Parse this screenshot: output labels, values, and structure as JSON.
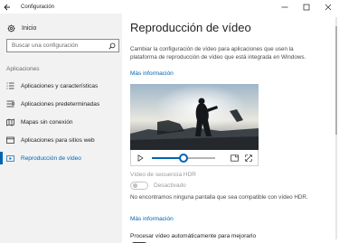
{
  "window": {
    "title": "Configuración",
    "controls": [
      "minimize-icon",
      "maximize-icon",
      "close-icon"
    ]
  },
  "sidebar": {
    "home_label": "Inicio",
    "search_placeholder": "Buscar una configuración",
    "section_label": "Aplicaciones",
    "items": [
      {
        "label": "Aplicaciones y características",
        "icon": "list-icon"
      },
      {
        "label": "Aplicaciones predeterminadas",
        "icon": "default-apps-icon"
      },
      {
        "label": "Mapas sin conexión",
        "icon": "map-icon"
      },
      {
        "label": "Aplicaciones para sitios web",
        "icon": "web-apps-icon"
      },
      {
        "label": "Reproducción de vídeo",
        "icon": "video-icon",
        "active": true
      }
    ]
  },
  "main": {
    "title": "Reproducción de vídeo",
    "description": "Cambiar la configuración de vídeo para aplicaciones que usen la plataforma de reproducción de vídeo que está integrada en Windows.",
    "more_info_1": "Más información",
    "video": {
      "progress": 0.5
    },
    "hdr_label": "Vídeo de secuencia HDR",
    "hdr_toggle_label": "Desactivado",
    "hdr_toggle_on": false,
    "hdr_note": "No encontramos ninguna pantalla que sea compatible con vídeo HDR.",
    "more_info_2": "Más información",
    "process_label": "Procesar vídeo automáticamente para mejorarlo"
  },
  "colors": {
    "accent": "#0063b1",
    "sidebar_bg": "#f2f2f2"
  }
}
